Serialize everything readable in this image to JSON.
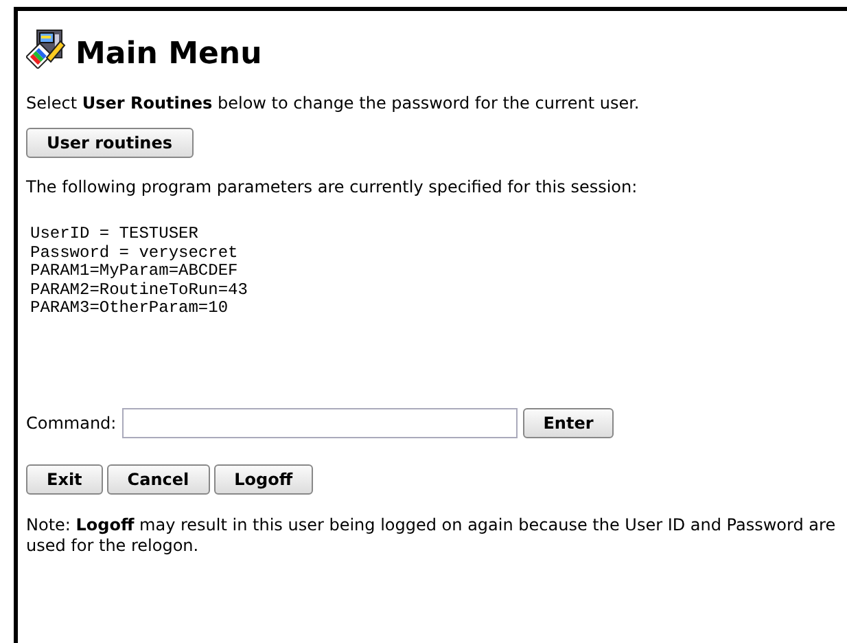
{
  "title": "Main Menu",
  "intro": "Select **User Routines** below to change the password for the current user.",
  "routines_button": "User routines",
  "params_heading": "The following program parameters are currently specified for this session:",
  "params": [
    "UserID = TESTUSER",
    "Password = verysecret",
    "PARAM1=MyParam=ABCDEF",
    "PARAM2=RoutineToRun=43",
    "PARAM3=OtherParam=10"
  ],
  "command": {
    "label": "Command:",
    "button": "Enter"
  },
  "buttons": [
    "Exit",
    "Cancel",
    "Logoff"
  ],
  "note": "Note: **Logoff** may result in this user being logged on again because the User ID and Password are used for the relogon."
}
